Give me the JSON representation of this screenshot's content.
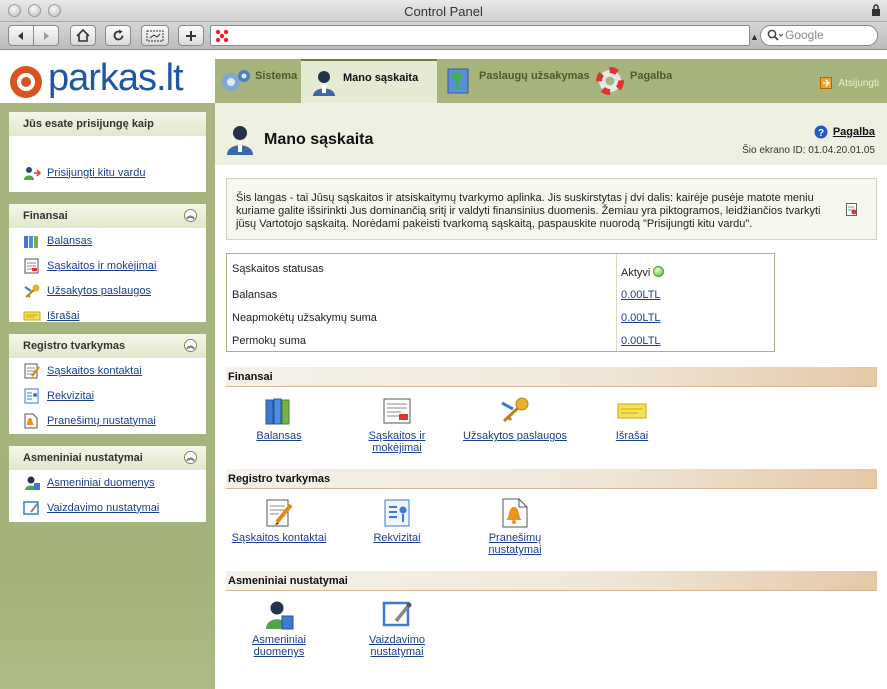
{
  "browser": {
    "window_title": "Control Panel",
    "search_placeholder": "Google",
    "url": ""
  },
  "header": {
    "logo_text": "parkas.lt",
    "tabs": [
      {
        "label": "Sistema",
        "active": false
      },
      {
        "label": "Mano sąskaita",
        "active": true
      },
      {
        "label": "Paslaugų užsakymas",
        "active": false
      },
      {
        "label": "Pagalba",
        "active": false
      }
    ],
    "logout_label": "Atsijungti"
  },
  "sidebar": {
    "login_panel": {
      "title": "Jūs esate prisijungę kaip",
      "switch_user": "Prisijungti kitu vardu"
    },
    "finansai": {
      "title": "Finansai",
      "items": [
        "Balansas",
        "Sąskaitos ir mokėjimai",
        "Užsakytos paslaugos",
        "Išrašai"
      ]
    },
    "registro": {
      "title": "Registro tvarkymas",
      "items": [
        "Sąskaitos kontaktai",
        "Rekvizitai",
        "Pranešimų nustatymai"
      ]
    },
    "asmeniniai": {
      "title": "Asmeniniai nustatymai",
      "items": [
        "Asmeniniai duomenys",
        "Vaizdavimo nustatymai"
      ]
    }
  },
  "main": {
    "title": "Mano sąskaita",
    "help_label": "Pagalba",
    "screen_id": "Šio ekrano ID: 01.04.20.01.05",
    "info_text": "Šis langas - tai Jūsų sąskaitos ir atsiskaitymų tvarkymo aplinka. Jis suskirstytas į dvi dalis: kairėje pusėje matote meniu kuriame galite išsirinkti Jus dominančią sritį ir valdyti finansinius duomenis. Žemiau yra piktogramos, leidžiančios tvarkyti jūsų Vartotojo sąskaitą. Norėdami pakeisti tvarkomą sąskaitą, paspauskite nuorodą \"Prisijungti kitu vardu\".",
    "status": {
      "rows": [
        {
          "label": "Sąskaitos statusas",
          "value": "Aktyvi"
        },
        {
          "label": "Balansas",
          "value": "0.00LTL"
        },
        {
          "label": "Neapmokėtų užsakymų suma",
          "value": "0.00LTL"
        },
        {
          "label": "Permokų suma",
          "value": "0.00LTL"
        }
      ]
    },
    "sections": [
      {
        "title": "Finansai",
        "tiles": [
          {
            "l1": "Balansas",
            "l2": ""
          },
          {
            "l1": "Sąskaitos ir",
            "l2": "mokėjimai"
          },
          {
            "l1": "Užsakytos paslaugos",
            "l2": ""
          },
          {
            "l1": "Išrašai",
            "l2": ""
          }
        ]
      },
      {
        "title": "Registro tvarkymas",
        "tiles": [
          {
            "l1": "Sąskaitos kontaktai",
            "l2": ""
          },
          {
            "l1": "Rekvizitai",
            "l2": ""
          },
          {
            "l1": "Pranešimų",
            "l2": "nustatymai"
          }
        ]
      },
      {
        "title": "Asmeniniai nustatymai",
        "tiles": [
          {
            "l1": "Asmeniniai",
            "l2": "duomenys"
          },
          {
            "l1": "Vaizdavimo",
            "l2": "nustatymai"
          }
        ]
      }
    ]
  },
  "colors": {
    "nav_green": "#a7b57c",
    "link_blue": "#1b3f91",
    "logo_blue": "#1e57a8"
  }
}
